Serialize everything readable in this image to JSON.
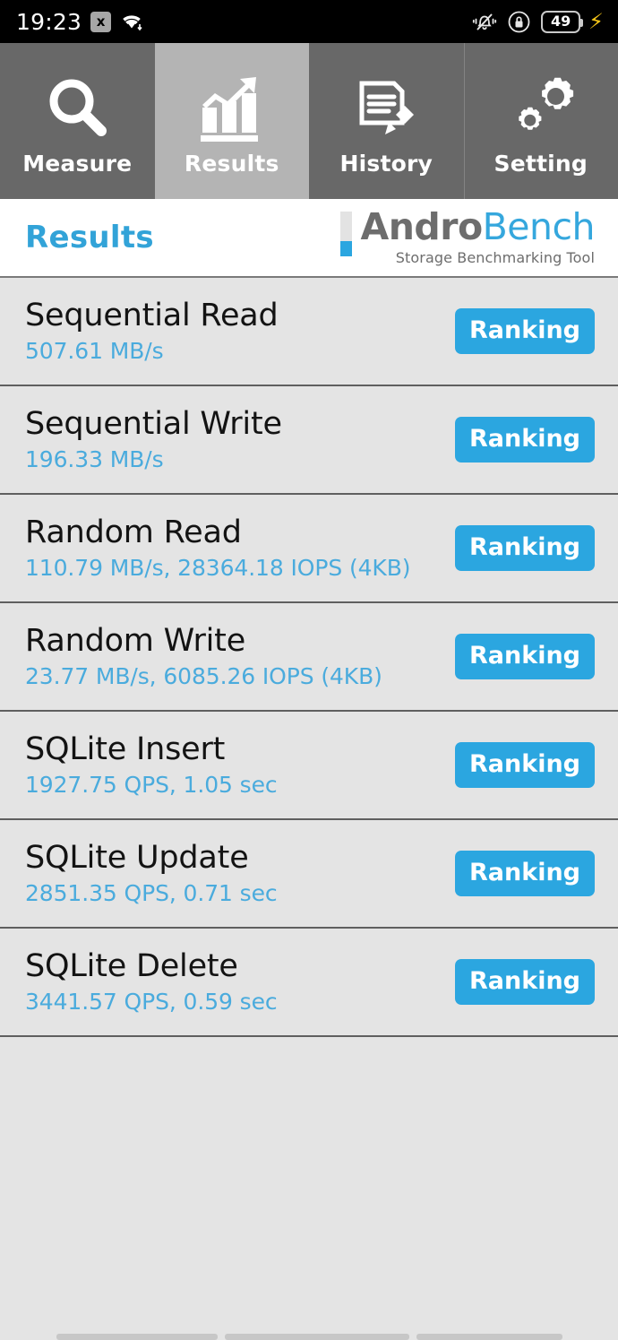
{
  "status_bar": {
    "time": "19:23",
    "x_badge_label": "x",
    "wifi_icon": "wifi-icon",
    "silent_icon": "vibrate-silent-icon",
    "rotation_lock_icon": "rotation-lock-icon",
    "battery_level": "49",
    "charging_icon": "charging-bolt-icon"
  },
  "tabs": [
    {
      "label": "Measure",
      "icon": "magnifier-icon",
      "active": false
    },
    {
      "label": "Results",
      "icon": "bar-chart-arrow-icon",
      "active": true
    },
    {
      "label": "History",
      "icon": "document-pencil-icon",
      "active": false
    },
    {
      "label": "Setting",
      "icon": "gears-icon",
      "active": false
    }
  ],
  "header": {
    "title": "Results",
    "logo_part1": "Andro",
    "logo_part2": "Bench",
    "logo_tagline": "Storage Benchmarking Tool"
  },
  "results": [
    {
      "title": "Sequential Read",
      "value": "507.61 MB/s",
      "button": "Ranking"
    },
    {
      "title": "Sequential Write",
      "value": "196.33 MB/s",
      "button": "Ranking"
    },
    {
      "title": "Random Read",
      "value": "110.79 MB/s, 28364.18 IOPS (4KB)",
      "button": "Ranking"
    },
    {
      "title": "Random Write",
      "value": "23.77 MB/s, 6085.26 IOPS (4KB)",
      "button": "Ranking"
    },
    {
      "title": "SQLite Insert",
      "value": "1927.75 QPS, 1.05 sec",
      "button": "Ranking"
    },
    {
      "title": "SQLite Update",
      "value": "2851.35 QPS, 0.71 sec",
      "button": "Ranking"
    },
    {
      "title": "SQLite Delete",
      "value": "3441.57 QPS, 0.59 sec",
      "button": "Ranking"
    }
  ],
  "colors": {
    "accent_blue": "#2ba6e0",
    "value_blue": "#4aabdd",
    "title_blue": "#32a3d8",
    "tab_inactive": "#686868",
    "tab_active": "#b4b4b4",
    "list_background": "#e4e4e4"
  },
  "nav_bar": {
    "segments": [
      "recents-bar",
      "home-bar",
      "back-bar"
    ]
  }
}
